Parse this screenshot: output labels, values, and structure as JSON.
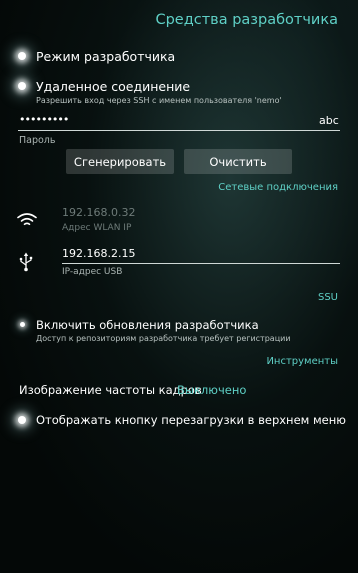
{
  "header": {
    "title": "Средства разработчика"
  },
  "developer_mode": {
    "label": "Режим разработчика"
  },
  "remote_connection": {
    "label": "Удаленное соединение",
    "description": "Разрешить вход через SSH с именем пользователя 'nemo'",
    "password_value": "•••••••••",
    "password_label": "Пароль",
    "keyboard_hint": "abc"
  },
  "buttons": {
    "generate": "Сгенерировать",
    "clear": "Очистить"
  },
  "links": {
    "network": "Сетевые подключения",
    "ssu": "SSU",
    "tools": "Инструменты"
  },
  "wlan": {
    "ip": "192.168.0.32",
    "label": "Адрес WLAN IP"
  },
  "usb": {
    "ip": "192.168.2.15",
    "label": "IP-адрес USB"
  },
  "updates": {
    "label": "Включить обновления разработчика",
    "description": "Доступ к репозиториям разработчика требует регистрации"
  },
  "frame_rate": {
    "label": "Изображение частоты кадров",
    "value": "Выключено"
  },
  "reboot_menu": {
    "label": "Отображать кнопку перезагрузки в верхнем меню"
  },
  "colors": {
    "accent": "#5fd0c6",
    "background": "#050a09"
  },
  "icons": [
    "wifi-icon",
    "usb-icon"
  ]
}
